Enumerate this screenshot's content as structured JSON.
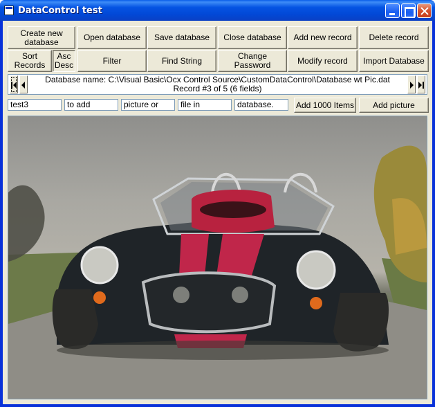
{
  "window": {
    "title": "DataControl test"
  },
  "toolbar": {
    "create_new_database": "Create new\ndatabase",
    "open_database": "Open database",
    "save_database": "Save database",
    "close_database": "Close database",
    "add_new_record": "Add new record",
    "delete_record": "Delete record",
    "sort_records": "Sort\nRecords",
    "asc_desc": "Asc\nDesc",
    "filter": "Filter",
    "find_string": "Find String",
    "change_password": "Change Password",
    "modify_record": "Modify record",
    "import_database": "Import Database"
  },
  "navigator": {
    "database_name": "Database name: C:\\Visual Basic\\Ocx Control Source\\CustomDataControl\\Database wt Pic.dat",
    "record_status": "Record #3 of 5 (6 fields)"
  },
  "fields": {
    "values": [
      "test3",
      "to add",
      "picture or",
      "file in",
      "database."
    ],
    "add_1000_items": "Add 1000 Items",
    "add_picture": "Add picture"
  },
  "picture": {
    "description": "car-photo"
  }
}
